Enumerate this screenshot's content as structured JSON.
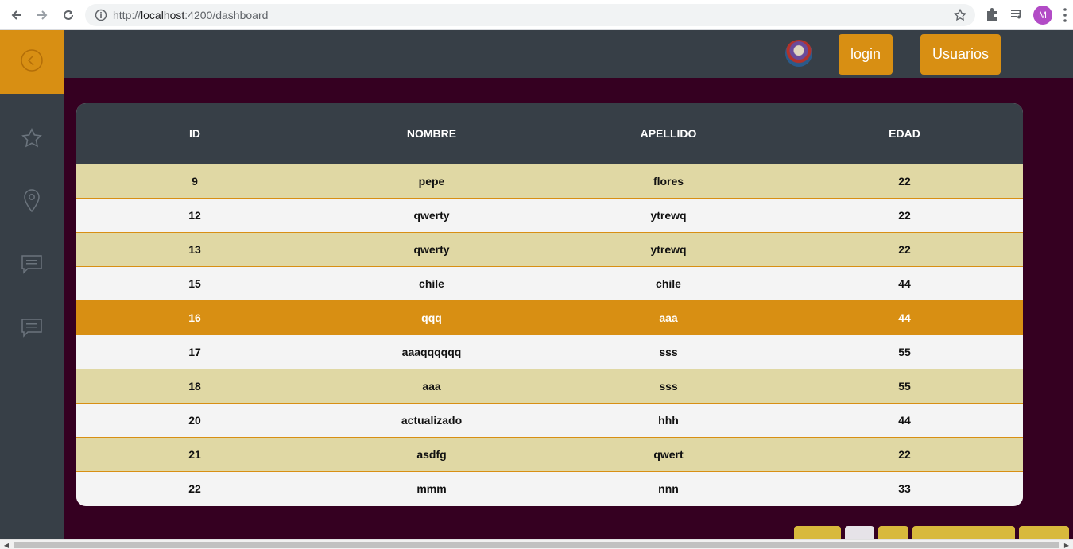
{
  "browser": {
    "url_scheme": "http://",
    "url_host": "localhost",
    "url_rest": ":4200/dashboard",
    "profile_initial": "M"
  },
  "colors": {
    "accent": "#d88f13",
    "dark": "#373f47",
    "background": "#350021",
    "row_alt": "#e0d8a4"
  },
  "header": {
    "login_label": "login",
    "users_label": "Usuarios"
  },
  "sidebar": {
    "items": [
      {
        "icon": "chevron-left-circle-icon"
      },
      {
        "icon": "star-icon"
      },
      {
        "icon": "location-pin-icon"
      },
      {
        "icon": "comment-icon"
      },
      {
        "icon": "comment-icon"
      }
    ]
  },
  "table": {
    "headers": [
      "ID",
      "NOMBRE",
      "APELLIDO",
      "EDAD"
    ],
    "rows": [
      [
        "9",
        "pepe",
        "flores",
        "22"
      ],
      [
        "12",
        "qwerty",
        "ytrewq",
        "22"
      ],
      [
        "13",
        "qwerty",
        "ytrewq",
        "22"
      ],
      [
        "15",
        "chile",
        "chile",
        "44"
      ],
      [
        "16",
        "qqq",
        "aaa",
        "44"
      ],
      [
        "17",
        "aaaqqqqqq",
        "sss",
        "55"
      ],
      [
        "18",
        "aaa",
        "sss",
        "55"
      ],
      [
        "20",
        "actualizado",
        "hhh",
        "44"
      ],
      [
        "21",
        "asdfg",
        "qwert",
        "22"
      ],
      [
        "22",
        "mmm",
        "nnn",
        "33"
      ]
    ],
    "active_row_index": 4
  }
}
